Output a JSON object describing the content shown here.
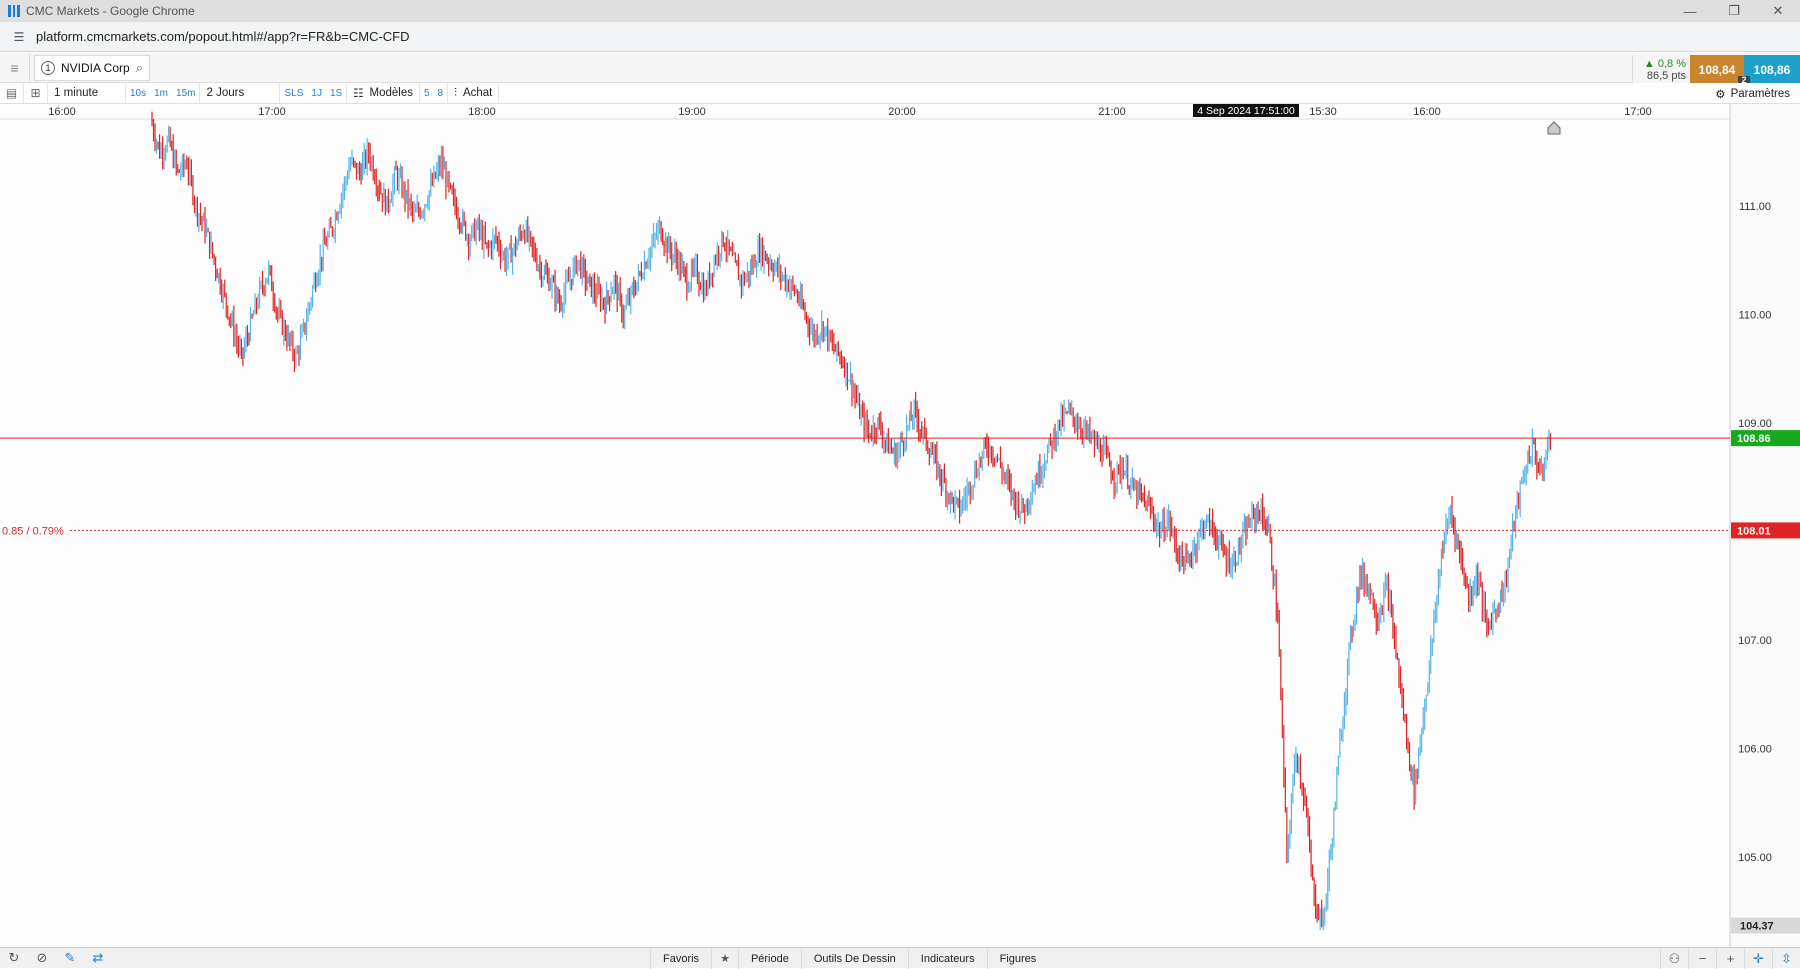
{
  "browser": {
    "title": "CMC Markets - Google Chrome",
    "url": "platform.cmcmarkets.com/popout.html#/app?r=FR&b=CMC-CFD"
  },
  "instrument": {
    "number": "1",
    "name": "NVIDIA Corp"
  },
  "quote": {
    "change_pct": "▲ 0,8 %",
    "change_pts": "86,5 pts",
    "sell": "108,84",
    "buy": "108,86",
    "spread": "2"
  },
  "chart_toolbar": {
    "interval": "1 minute",
    "tf_10s": "10s",
    "tf_1m": "1m",
    "tf_15m": "15m",
    "range": "2 Jours",
    "sls": "SLS",
    "p1j": "1J",
    "p1s": "1S",
    "models": "Modèles",
    "n5": "5",
    "n8": "8",
    "achat": "Achat",
    "params": "Paramètres"
  },
  "bottom": {
    "favoris": "Favoris",
    "periode": "Période",
    "outils": "Outils De Dessin",
    "indicateurs": "Indicateurs",
    "figures": "Figures"
  },
  "chart_data": {
    "type": "candlestick",
    "time_ticks": [
      "16:00",
      "17:00",
      "18:00",
      "19:00",
      "20:00",
      "21:00",
      "15:30",
      "16:00",
      "17:00"
    ],
    "crosshair_time": "4 Sep 2024 17:51:00",
    "y_ticks": [
      "111.00",
      "110.00",
      "109.00",
      "107.00",
      "106.00",
      "105.00"
    ],
    "ylim": [
      104.2,
      111.8
    ],
    "current_price": "108.86",
    "reference_price": "108.01",
    "reference_label": "0.85 / 0.79%",
    "low_label": "104.37",
    "up_color": "#5ab4e6",
    "down_color": "#e02424",
    "path": [
      111.8,
      111.5,
      111.6,
      111.3,
      111.4,
      111.0,
      110.8,
      110.5,
      110.2,
      109.9,
      109.6,
      109.9,
      110.2,
      110.4,
      110.0,
      109.8,
      109.6,
      109.9,
      110.3,
      110.6,
      110.8,
      111.1,
      111.4,
      111.3,
      111.5,
      111.2,
      111.0,
      111.3,
      111.1,
      110.9,
      111.0,
      111.2,
      111.4,
      111.1,
      110.9,
      110.7,
      110.8,
      110.6,
      110.7,
      110.5,
      110.6,
      110.8,
      110.6,
      110.4,
      110.3,
      110.1,
      110.3,
      110.5,
      110.3,
      110.2,
      110.1,
      110.3,
      110.0,
      110.2,
      110.4,
      110.6,
      110.8,
      110.6,
      110.5,
      110.3,
      110.4,
      110.2,
      110.5,
      110.7,
      110.5,
      110.3,
      110.4,
      110.6,
      110.5,
      110.4,
      110.3,
      110.2,
      110.0,
      109.8,
      109.9,
      109.7,
      109.6,
      109.4,
      109.1,
      108.9,
      109.0,
      108.8,
      108.7,
      108.9,
      109.1,
      108.9,
      108.7,
      108.5,
      108.3,
      108.2,
      108.4,
      108.6,
      108.8,
      108.7,
      108.5,
      108.3,
      108.2,
      108.4,
      108.6,
      108.8,
      109.0,
      109.1,
      109.0,
      108.9,
      108.8,
      108.7,
      108.5,
      108.6,
      108.4,
      108.3,
      108.2,
      108.0,
      108.1,
      107.8,
      107.7,
      107.9,
      108.1,
      108.0,
      107.8,
      107.7,
      107.9,
      108.1,
      108.2,
      108.0,
      107.2,
      105.0,
      106.0,
      105.5,
      104.6,
      104.4,
      105.2,
      106.2,
      107.0,
      107.6,
      107.5,
      107.2,
      107.5,
      106.9,
      106.2,
      105.6,
      106.3,
      107.0,
      107.8,
      108.2,
      107.8,
      107.4,
      107.6,
      107.1,
      107.3,
      107.5,
      108.1,
      108.5,
      108.8,
      108.5,
      108.9
    ]
  }
}
